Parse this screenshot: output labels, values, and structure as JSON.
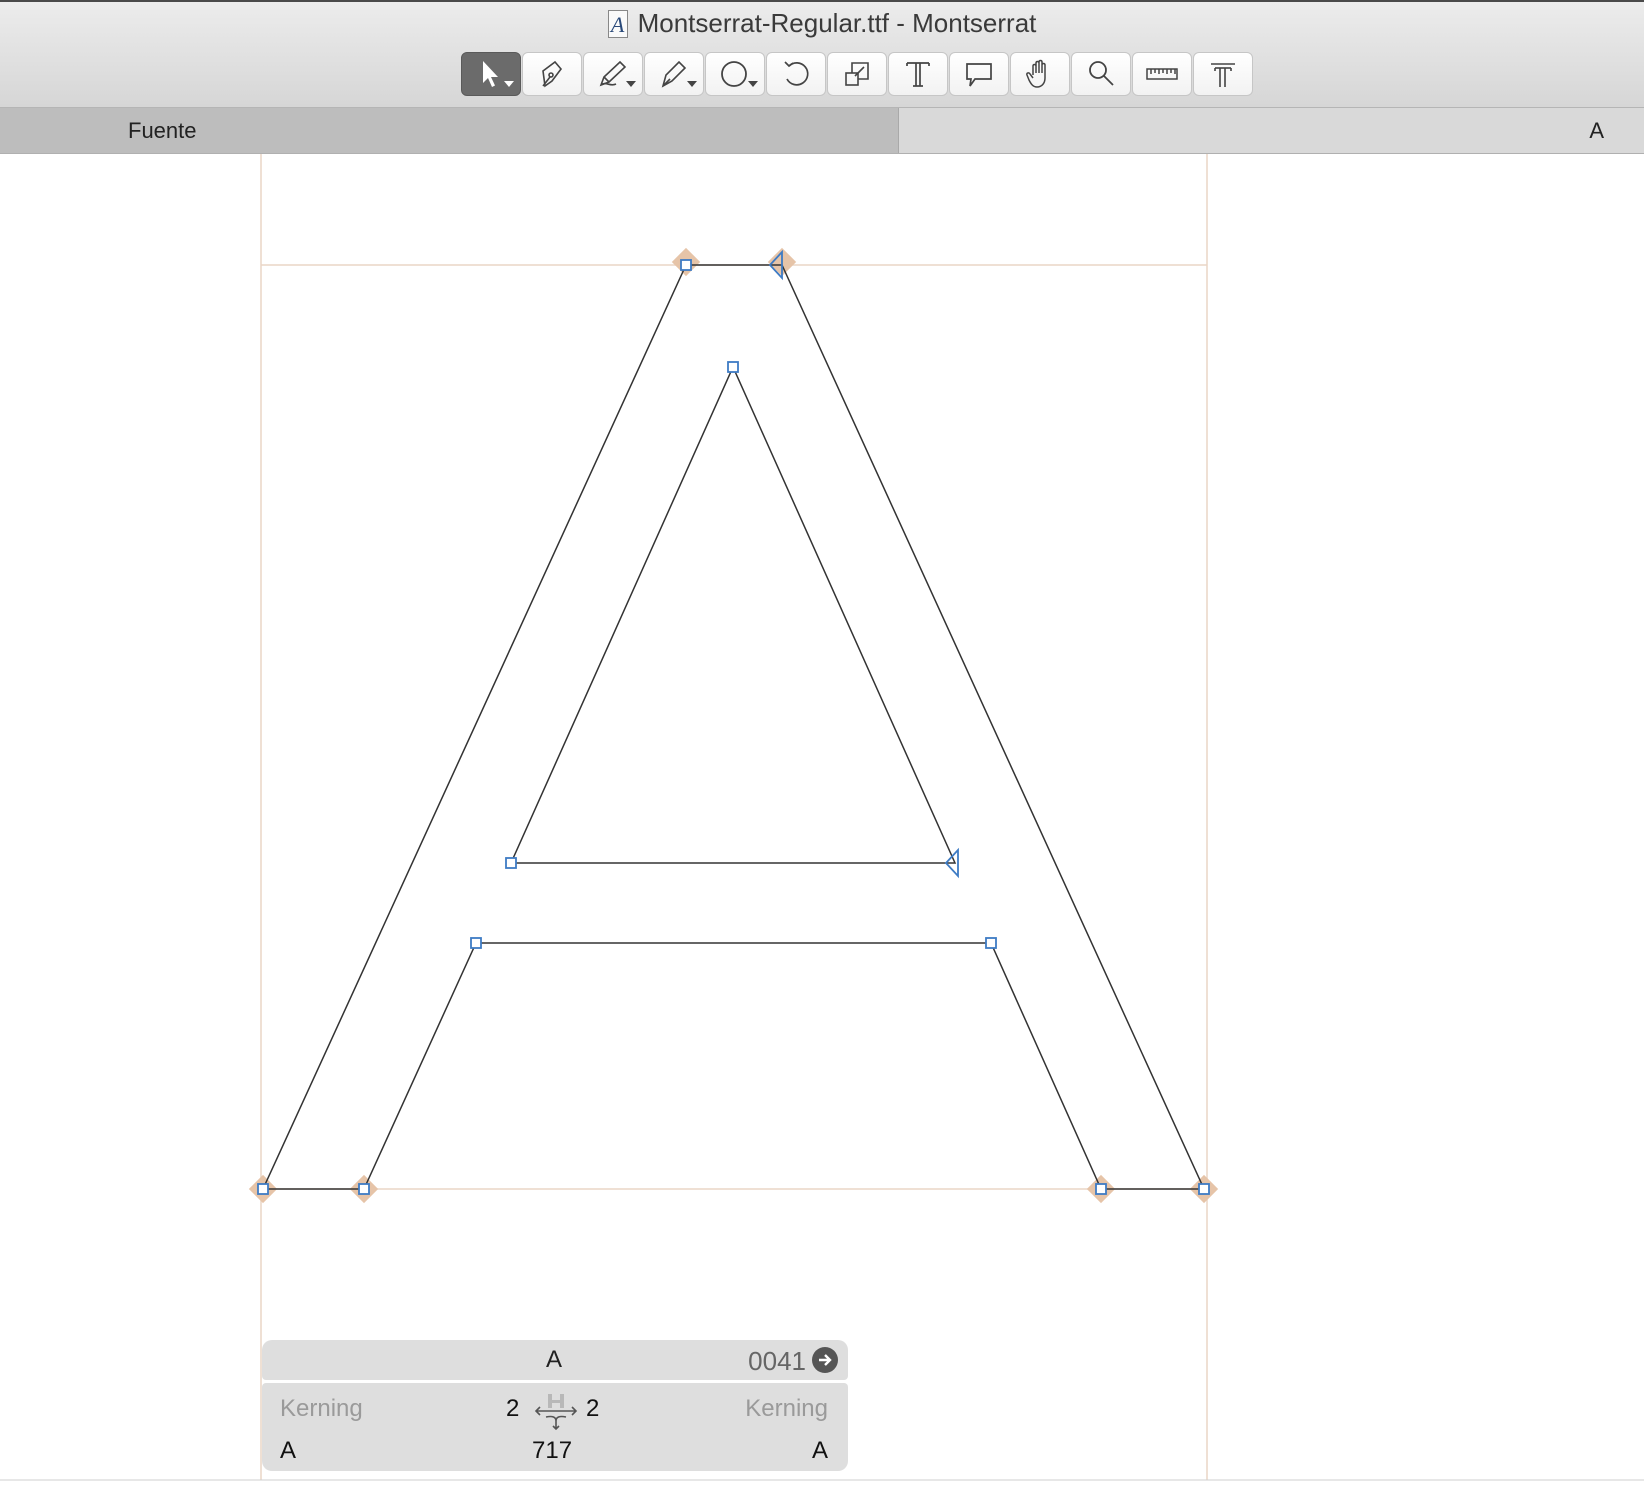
{
  "window": {
    "title": "Montserrat-Regular.ttf - Montserrat",
    "doc_icon": "A"
  },
  "toolbar": {
    "tools": [
      {
        "name": "pointer-tool",
        "icon": "arrow-pointer-icon",
        "active": true
      },
      {
        "name": "pen-tool",
        "icon": "pen-nib-icon"
      },
      {
        "name": "pencil-tool",
        "icon": "pencil-icon"
      },
      {
        "name": "calligraphy-pen-tool",
        "icon": "calligraphy-pen-icon"
      },
      {
        "name": "shape-tool",
        "icon": "circle-shape-icon"
      },
      {
        "name": "rotate-tool",
        "icon": "rotate-icon"
      },
      {
        "name": "scale-tool",
        "icon": "scale-icon"
      },
      {
        "name": "text-tool",
        "icon": "text-icon"
      },
      {
        "name": "comment-tool",
        "icon": "speech-bubble-icon"
      },
      {
        "name": "hand-tool",
        "icon": "hand-icon"
      },
      {
        "name": "zoom-tool",
        "icon": "magnifier-icon"
      },
      {
        "name": "measure-tool",
        "icon": "ruler-icon"
      },
      {
        "name": "metrics-tool",
        "icon": "metrics-icon"
      }
    ]
  },
  "tabs": {
    "left_label": "Fuente",
    "right_label": "A"
  },
  "glyph_info": {
    "glyph": "A",
    "unicode": "0041",
    "left_kerning_label": "Kerning",
    "right_kerning_label": "Kerning",
    "left_sidebearing": "2",
    "right_sidebearing": "2",
    "left_glyph": "A",
    "right_glyph": "A",
    "advance_width": "717"
  },
  "colors": {
    "accent": "#3e7bc4",
    "guide": "#ead6c6",
    "node_highlight": "#e6c4a8",
    "outline": "#333333"
  }
}
